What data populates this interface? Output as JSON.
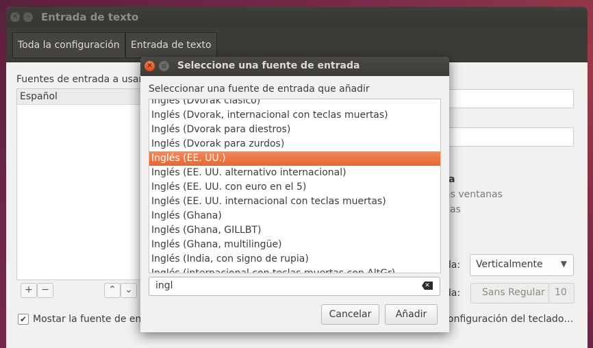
{
  "main_window": {
    "title": "Entrada de texto",
    "breadcrumbs": [
      "Toda la configuración",
      "Entrada de texto"
    ],
    "sources_label": "Fuentes de entrada a usar:",
    "sources": [
      "Español"
    ],
    "add_symbol": "+",
    "remove_symbol": "−",
    "up_symbol": "⌃",
    "down_symbol": "⌄",
    "show_source_label": "Mostar la fuente de ent",
    "show_source_checked": true,
    "partial_right_1": "a",
    "partial_right_2": "as ventanas",
    "partial_right_3": "as",
    "orientation_label_partial": "da:",
    "orientation_value": "Verticalmente",
    "font_label_partial": "da:",
    "font_name": "Sans Regular",
    "font_size": "10",
    "keyboard_config_label": "onfiguración del teclado…"
  },
  "dialog": {
    "title": "Seleccione una fuente de entrada",
    "prompt": "Seleccionar una fuente de entrada que añadir",
    "items": [
      "Inglés (Dvorak clásico)",
      "Inglés (Dvorak, internacional con teclas muertas)",
      "Inglés (Dvorak para diestros)",
      "Inglés (Dvorak para zurdos)",
      "Inglés (EE. UU.)",
      "Inglés (EE. UU. alternativo internacional)",
      "Inglés (EE. UU. con euro en el 5)",
      "Inglés (EE. UU. internacional con teclas muertas)",
      "Inglés (Ghana)",
      "Inglés (Ghana, GILLBT)",
      "Inglés (Ghana, multilingüe)",
      "Inglés (India, con signo de rupia)",
      "Inglés (internacional con teclas muertas con AltGr)"
    ],
    "selected_index": 4,
    "search_value": "ingl",
    "cancel_label": "Cancelar",
    "add_label": "Añadir"
  },
  "colors": {
    "accent": "#e9662f",
    "titlebar": "#3c3b37"
  }
}
